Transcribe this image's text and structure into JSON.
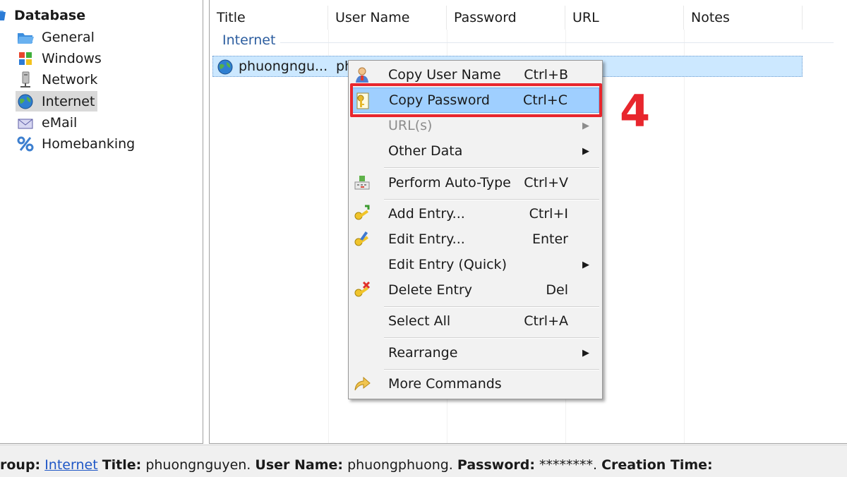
{
  "tree": {
    "root_label": "Database",
    "items": [
      {
        "label": "General",
        "icon": "folder-icon"
      },
      {
        "label": "Windows",
        "icon": "windows-icon"
      },
      {
        "label": "Network",
        "icon": "network-icon"
      },
      {
        "label": "Internet",
        "icon": "globe-icon",
        "selected": true
      },
      {
        "label": "eMail",
        "icon": "envelope-icon"
      },
      {
        "label": "Homebanking",
        "icon": "percent-icon"
      }
    ]
  },
  "list": {
    "columns": [
      "Title",
      "User Name",
      "Password",
      "URL",
      "Notes"
    ],
    "group_label": "Internet",
    "entry": {
      "title": "phuongngu...",
      "user": "ph"
    }
  },
  "context_menu": {
    "items": [
      {
        "label": "Copy User Name",
        "shortcut": "Ctrl+B",
        "icon": "user-icon"
      },
      {
        "label": "Copy Password",
        "shortcut": "Ctrl+C",
        "icon": "key-icon",
        "highlighted": true
      },
      {
        "label": "URL(s)",
        "shortcut": "",
        "disabled": true,
        "submenu": true
      },
      {
        "label": "Other Data",
        "shortcut": "",
        "submenu": true
      },
      {
        "label": "Perform Auto-Type",
        "shortcut": "Ctrl+V",
        "icon": "auto-type-icon"
      },
      {
        "label": "Add Entry...",
        "shortcut": "Ctrl+I",
        "icon": "add-key-icon"
      },
      {
        "label": "Edit Entry...",
        "shortcut": "Enter",
        "icon": "edit-key-icon"
      },
      {
        "label": "Edit Entry (Quick)",
        "shortcut": "",
        "submenu": true
      },
      {
        "label": "Delete Entry",
        "shortcut": "Del",
        "icon": "delete-key-icon"
      },
      {
        "label": "Select All",
        "shortcut": "Ctrl+A"
      },
      {
        "label": "Rearrange",
        "shortcut": "",
        "submenu": true
      },
      {
        "label": "More Commands",
        "shortcut": "",
        "icon": "arrow-icon"
      }
    ]
  },
  "annotation": {
    "step_number": "4"
  },
  "status_bar": {
    "group_label": "roup:",
    "group_value": "Internet",
    "title_label": "Title:",
    "title_value": "phuongnguyen.",
    "user_label": "User Name:",
    "user_value": "phuongphuong.",
    "password_label": "Password:",
    "password_value": "********.",
    "creation_label": "Creation Time:"
  },
  "colors": {
    "accent_red": "#e8262d",
    "selection": "#cce8ff",
    "menu_highlight": "#9fcfff",
    "group_blue": "#2c5d9f"
  }
}
